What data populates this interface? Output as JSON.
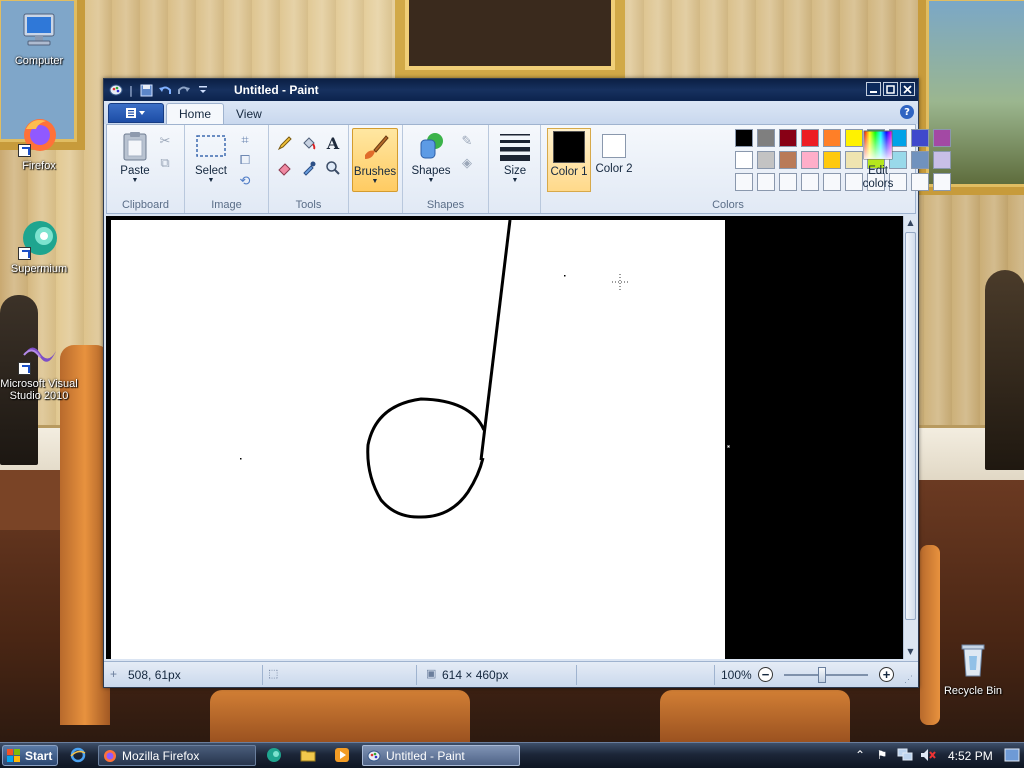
{
  "desktop": {
    "icons": [
      {
        "label": "Computer"
      },
      {
        "label": "Firefox"
      },
      {
        "label": "Supermium"
      },
      {
        "label": "Microsoft Visual Studio 2010"
      },
      {
        "label": "Recycle Bin"
      }
    ]
  },
  "window": {
    "title": "Untitled - Paint",
    "tabs": [
      {
        "label": "Home"
      },
      {
        "label": "View"
      }
    ],
    "help": "?"
  },
  "ribbon": {
    "clipboard": {
      "paste": "Paste",
      "group": "Clipboard"
    },
    "image": {
      "select": "Select",
      "group": "Image"
    },
    "tools": {
      "group": "Tools",
      "text_icon": "A"
    },
    "brushes": {
      "label": "Brushes"
    },
    "shapes": {
      "label": "Shapes",
      "group": "Shapes"
    },
    "size": {
      "label": "Size"
    },
    "colors": {
      "color1": "Color 1",
      "color2": "Color 2",
      "edit": "Edit colors",
      "group": "Colors",
      "color1_value": "#000000",
      "color2_value": "#ffffff",
      "palette_row1": [
        "#000000",
        "#7f7f7f",
        "#880015",
        "#ed1c24",
        "#ff7f27",
        "#fff200",
        "#22b14c",
        "#00a2e8",
        "#3f48cc",
        "#a349a4"
      ],
      "palette_row2": [
        "#ffffff",
        "#c3c3c3",
        "#b97a57",
        "#ffaec9",
        "#ffc90e",
        "#efe4b0",
        "#b5e61d",
        "#99d9ea",
        "#7092be",
        "#c8bfe7"
      ]
    }
  },
  "status": {
    "cursor_pos": "508, 61px",
    "canvas_size": "614 × 460px",
    "zoom": "100%",
    "zoom_fraction": 0.45
  },
  "taskbar": {
    "start": "Start",
    "buttons": [
      {
        "label": "Mozilla Firefox"
      },
      {
        "label": "Untitled - Paint"
      }
    ],
    "clock": "4:52 PM"
  }
}
